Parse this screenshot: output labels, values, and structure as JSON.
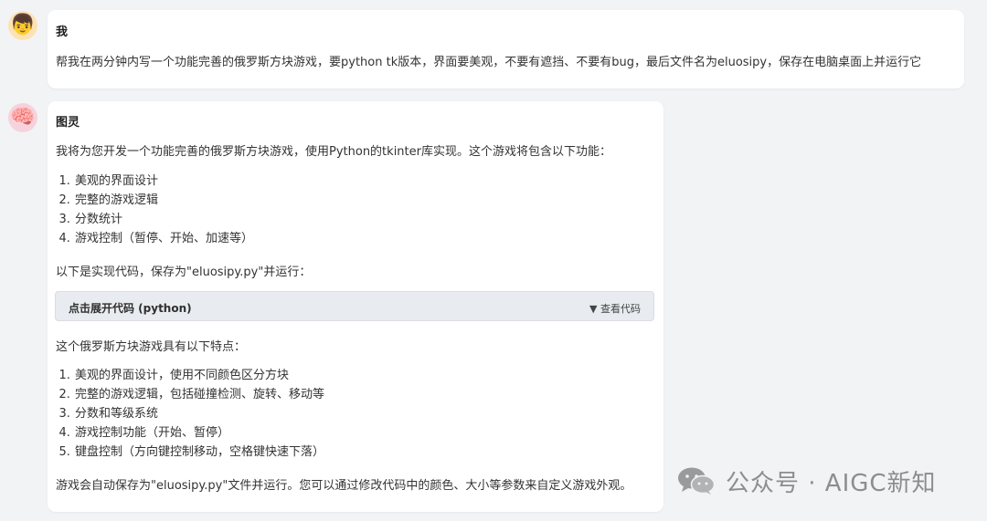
{
  "user_message": {
    "avatar_icon": "boy-face-icon",
    "sender": "我",
    "text": "帮我在两分钟内写一个功能完善的俄罗斯方块游戏，要python tk版本，界面要美观，不要有遮挡、不要有bug，最后文件名为eluosipy，保存在电脑桌面上并运行它"
  },
  "bot_message": {
    "avatar_icon": "brain-icon",
    "sender": "图灵",
    "intro": "我将为您开发一个功能完善的俄罗斯方块游戏，使用Python的tkinter库实现。这个游戏将包含以下功能：",
    "features": [
      "美观的界面设计",
      "完整的游戏逻辑",
      "分数统计",
      "游戏控制（暂停、开始、加速等）"
    ],
    "code_intro": "以下是实现代码，保存为\"eluosipy.py\"并运行：",
    "code_toggle_label": "点击展开代码 (python)",
    "code_view_label": "▼ 查看代码",
    "traits_intro": "这个俄罗斯方块游戏具有以下特点：",
    "traits": [
      "美观的界面设计，使用不同颜色区分方块",
      "完整的游戏逻辑，包括碰撞检测、旋转、移动等",
      "分数和等级系统",
      "游戏控制功能（开始、暂停）",
      "键盘控制（方向键控制移动，空格键快速下落）"
    ],
    "footer": "游戏会自动保存为\"eluosipy.py\"文件并运行。您可以通过修改代码中的颜色、大小等参数来自定义游戏外观。"
  },
  "watermark": {
    "icon": "wechat-icon",
    "text": "公众号 · AIGC新知"
  }
}
